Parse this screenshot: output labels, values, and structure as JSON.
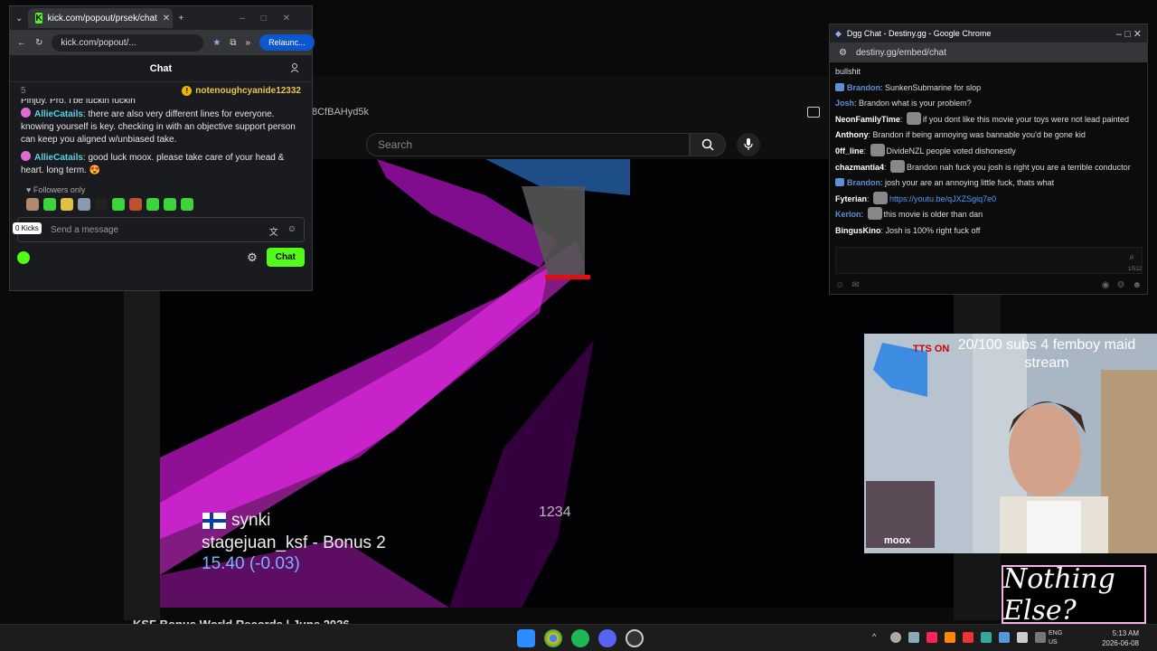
{
  "youtube": {
    "url_fragment": "8CfBAHyd5k",
    "search_placeholder": "Search",
    "video_title": "KSF Bonus World Records | June 2026"
  },
  "game_hud": {
    "player": "synki",
    "map": "stagejuan_ksf - Bonus 2",
    "time": "15.40 (-0.03)",
    "speed": "1234"
  },
  "kick": {
    "tab_title": "kick.com/popout/prsek/chat",
    "address": "kick.com/popout/...",
    "relaunch": "Relaunc...",
    "header": "Chat",
    "pinned_count": "5",
    "pinned_user": "notenoughcyanide12332",
    "cut_line": "Pinjuy. Pro. I'be fuckin fuckin",
    "messages": [
      {
        "user": "AllieCatails",
        "text": "there are also very different lines for everyone. knowing yourself is key. checking in with an objective support person can keep you aligned w/unbiased take."
      },
      {
        "user": "AllieCatails",
        "text": "good luck moox. please take care of your head & heart. long term. 😍"
      }
    ],
    "followers_only": "Followers only",
    "input_placeholder": "Send a message",
    "kicks_tooltip": "0 Kicks",
    "send_button": "Chat"
  },
  "dgg": {
    "window_title": "Dgg Chat - Destiny.gg - Google Chrome",
    "url": "destiny.gg/embed/chat",
    "char_count": "1/512",
    "messages": [
      {
        "user": "",
        "text": "bullshit",
        "color": "#dddddd"
      },
      {
        "user": "Brandon",
        "text": "SunkenSubmarine for slop",
        "color": "#5f8fd6",
        "flair": true
      },
      {
        "user": "Josh",
        "text": "Brandon what is your problem?",
        "color": "#5f8fd6"
      },
      {
        "user": "NeonFamilyTime",
        "text": "if you dont like this movie your toys were not lead painted",
        "color": "#ffffff",
        "emote": true
      },
      {
        "user": "Anthony",
        "text": "Brandon if being annoying was bannable you'd be gone kid",
        "color": "#ffffff"
      },
      {
        "user": "0ff_line",
        "text": "DivideNZL people voted dishonestly",
        "color": "#ffffff",
        "emote": true
      },
      {
        "user": "chazmantia4",
        "text": "Brandon nah fuck you josh is right you are a terrible conductor",
        "color": "#ffffff",
        "emote": true
      },
      {
        "user": "Brandon",
        "text": "josh your are an annoying little fuck, thats what",
        "color": "#5f8fd6",
        "flair": true
      },
      {
        "user": "Fyterian",
        "text": "",
        "link": "https://youtu.be/qJXZSgiq7e0",
        "color": "#ffffff",
        "emote": true
      },
      {
        "user": "Kerlon",
        "text": "this movie is older than dan",
        "color": "#5f8fd6",
        "emote": true
      },
      {
        "user": "BingusKino",
        "text": "Josh is 100% right fuck off",
        "color": "#ffffff"
      }
    ]
  },
  "stream_overlay": {
    "sub_goal": "20/100 subs 4 femboy maid stream",
    "tts": "TTS ON",
    "cam_name": "moox",
    "nothing_else": "Nothing Else?"
  },
  "taskbar": {
    "lang_top": "ENG",
    "lang_bottom": "US",
    "time": "5:13 AM",
    "date": "2026-06-08"
  }
}
